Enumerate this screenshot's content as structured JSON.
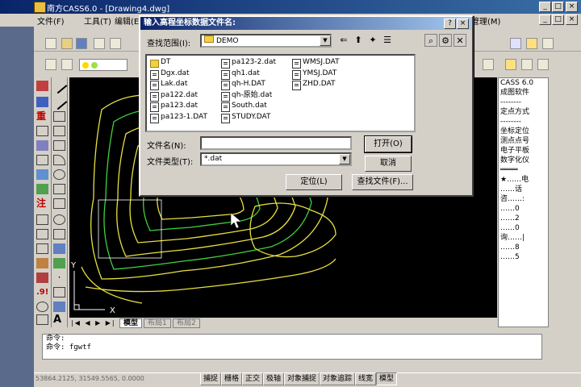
{
  "app": {
    "title": "南方CASS6.0 - [Drawing4.dwg]"
  },
  "window_controls": [
    "_",
    "□",
    "×"
  ],
  "menu": [
    "文件(F)",
    "工具(T)",
    "编辑(E)",
    "管理(M)"
  ],
  "dialog": {
    "title": "输入高程坐标数据文件名:",
    "lookin_label": "查找范围(I):",
    "lookin_value": "DEMO",
    "files": [
      {
        "name": "DT",
        "type": "folder"
      },
      {
        "name": "Dgx.dat",
        "type": "file"
      },
      {
        "name": "Lak.dat",
        "type": "file"
      },
      {
        "name": "pa122.dat",
        "type": "file"
      },
      {
        "name": "pa123.dat",
        "type": "file"
      },
      {
        "name": "pa123-1.DAT",
        "type": "file"
      },
      {
        "name": "pa123-2.dat",
        "type": "file"
      },
      {
        "name": "qh1.dat",
        "type": "file"
      },
      {
        "name": "qh-H.DAT",
        "type": "file"
      },
      {
        "name": "qh-原始.dat",
        "type": "file"
      },
      {
        "name": "South.dat",
        "type": "file"
      },
      {
        "name": "STUDY.DAT",
        "type": "file"
      },
      {
        "name": "WMSJ.DAT",
        "type": "file"
      },
      {
        "name": "YMSJ.DAT",
        "type": "file"
      },
      {
        "name": "ZHD.DAT",
        "type": "file"
      }
    ],
    "filename_label": "文件名(N):",
    "filename_value": "",
    "filetype_label": "文件类型(T):",
    "filetype_value": "*.dat",
    "open_button": "打开(O)",
    "cancel_button": "取消",
    "locate_button": "定位(L)",
    "find_button": "查找文件(F)..."
  },
  "right_panel": {
    "items": [
      "CASS 6.0",
      "成图软件",
      "--------",
      "定点方式",
      "--------",
      "坐标定位",
      "测点点号",
      "电子平板",
      "数字化仪",
      "════",
      "★……电",
      "……话",
      "咨……:",
      "……0",
      "……2",
      "……0",
      "询……|",
      "……8",
      "……5"
    ]
  },
  "layout_tabs": [
    "模型",
    "布局1",
    "布局2"
  ],
  "command": {
    "lines": [
      "命令:",
      "命令: fgwtf"
    ]
  },
  "status": {
    "coords": "53864.2125, 31549.5565, 0.0000",
    "buttons": [
      "捕捉",
      "栅格",
      "正交",
      "极轴",
      "对象捕捉",
      "对象追踪",
      "线宽",
      "模型"
    ]
  },
  "axis": {
    "x": "X",
    "y": "Y"
  },
  "colors": {
    "contour_yellow": "#e8e040",
    "contour_green": "#40d040",
    "canvas": "#000000"
  }
}
